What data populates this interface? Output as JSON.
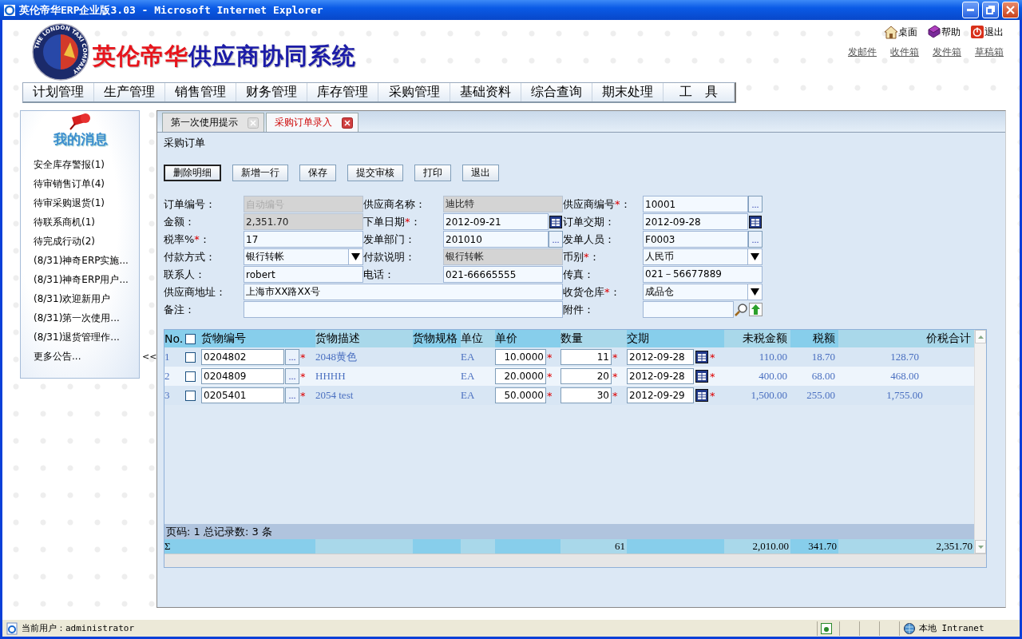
{
  "window": {
    "title": "英伦帝华ERP企业版3.03 - Microsoft Internet Explorer"
  },
  "header": {
    "logo_text": "THE LONDON TAXI COMPANY",
    "brand": [
      {
        "text": "英伦帝华",
        "color": "#e8141b"
      },
      {
        "text": "供应商协同系统",
        "color": "#1c1ca8"
      }
    ],
    "shortcuts": [
      {
        "kind": "home",
        "label": "桌面"
      },
      {
        "kind": "help",
        "label": "帮助"
      },
      {
        "kind": "exit",
        "label": "退出"
      }
    ],
    "mail_links": [
      "发邮件",
      "收件箱",
      "发件箱",
      "草稿箱"
    ]
  },
  "menu": [
    "计划管理",
    "生产管理",
    "销售管理",
    "财务管理",
    "库存管理",
    "采购管理",
    "基础资料",
    "综合查询",
    "期末处理",
    "工　具"
  ],
  "sidebar": {
    "title": "我的消息",
    "items": [
      "安全库存警报(1)",
      "待审销售订单(4)",
      "待审采购退货(1)",
      "待联系商机(1)",
      "待完成行动(2)",
      "(8/31)神奇ERP实施...",
      "(8/31)神奇ERP用户...",
      "(8/31)欢迎新用户",
      "(8/31)第一次使用...",
      "(8/31)退货管理作..."
    ],
    "more": "更多公告...",
    "toggle": "<<"
  },
  "tabs": [
    {
      "label": "第一次使用提示",
      "selected": false
    },
    {
      "label": "采购订单录入",
      "selected": true
    }
  ],
  "form": {
    "title": "采购订单",
    "colon": "：",
    "required_mark": "*",
    "lookup_label": "...",
    "buttons": [
      {
        "label": "删除明细",
        "focused": true
      },
      {
        "label": "新增一行",
        "focused": false
      },
      {
        "label": "保存",
        "focused": false
      },
      {
        "label": "提交审核",
        "focused": false
      },
      {
        "label": "打印",
        "focused": false
      },
      {
        "label": "退出",
        "focused": false
      }
    ],
    "fields": [
      {
        "label": "订单编号",
        "required": false,
        "kind": "text",
        "readonly": true,
        "placeholder": "自动编号"
      },
      {
        "label": "供应商名称",
        "required": false,
        "kind": "text",
        "readonly": true,
        "value": "迪比特"
      },
      {
        "label": "供应商编号",
        "required": true,
        "kind": "lookup",
        "readonly": false,
        "value": "10001"
      },
      {
        "label": "金额",
        "required": false,
        "kind": "text",
        "readonly": true,
        "value": "2,351.70"
      },
      {
        "label": "下单日期",
        "required": true,
        "kind": "date",
        "readonly": false,
        "value": "2012-09-21"
      },
      {
        "label": "订单交期",
        "required": false,
        "kind": "date",
        "readonly": false,
        "value": "2012-09-28"
      },
      {
        "label": "税率%",
        "required": true,
        "kind": "text",
        "readonly": false,
        "value": "17"
      },
      {
        "label": "发单部门",
        "required": false,
        "kind": "lookup",
        "readonly": false,
        "value": "201010"
      },
      {
        "label": "发单人员",
        "required": false,
        "kind": "lookup",
        "readonly": false,
        "value": "F0003"
      },
      {
        "label": "付款方式",
        "required": false,
        "kind": "select",
        "readonly": false,
        "value": "银行转帐"
      },
      {
        "label": "付款说明",
        "required": false,
        "kind": "text",
        "readonly": true,
        "value": "银行转帐"
      },
      {
        "label": "币别",
        "required": true,
        "kind": "select",
        "readonly": false,
        "value": "人民币"
      },
      {
        "label": "联系人",
        "required": false,
        "kind": "text",
        "readonly": false,
        "value": "robert"
      },
      {
        "label": "电话",
        "required": false,
        "kind": "text",
        "readonly": false,
        "value": "021-66665555"
      },
      {
        "label": "传真",
        "required": false,
        "kind": "text",
        "readonly": false,
        "value": "021－56677889"
      },
      {
        "label": "供应商地址",
        "required": false,
        "kind": "wide",
        "readonly": false,
        "value": "上海市XX路XX号"
      },
      {
        "label": "收货仓库",
        "required": true,
        "kind": "select",
        "readonly": false,
        "value": "成品仓"
      },
      {
        "label": "备注",
        "required": false,
        "kind": "wide",
        "readonly": false
      },
      {
        "label": "附件",
        "required": false,
        "kind": "file",
        "readonly": false
      }
    ]
  },
  "grid": {
    "columns": [
      "No.",
      "货物编号",
      "货物描述",
      "货物规格",
      "单位",
      "单价",
      "数量",
      "交期",
      "未税金额",
      "税额",
      "价税合计"
    ],
    "header_checked": false,
    "rows": [
      {
        "no": "1",
        "checked": false,
        "code": "0204802",
        "description": "2048黄色",
        "unit": "EA",
        "price": "10.0000",
        "qty": "11",
        "date": "2012-09-28",
        "amount": "110.00",
        "tax": "18.70",
        "total": "128.70"
      },
      {
        "no": "2",
        "checked": false,
        "code": "0204809",
        "description": "HHHH",
        "unit": "EA",
        "price": "20.0000",
        "qty": "20",
        "date": "2012-09-28",
        "amount": "400.00",
        "tax": "68.00",
        "total": "468.00"
      },
      {
        "no": "3",
        "checked": false,
        "code": "0205401",
        "description": "2054 test",
        "unit": "EA",
        "price": "50.0000",
        "qty": "30",
        "date": "2012-09-29",
        "amount": "1,500.00",
        "tax": "255.00",
        "total": "1,755.00"
      }
    ],
    "footer": "页码: 1 总记录数: 3 条",
    "totals": {
      "symbol": "Σ",
      "qty": "61",
      "amount": "2,010.00",
      "tax": "341.70",
      "total": "2,351.70"
    }
  },
  "status_bar": {
    "user": "当前用户：administrator",
    "zone": "本地 Intranet"
  }
}
